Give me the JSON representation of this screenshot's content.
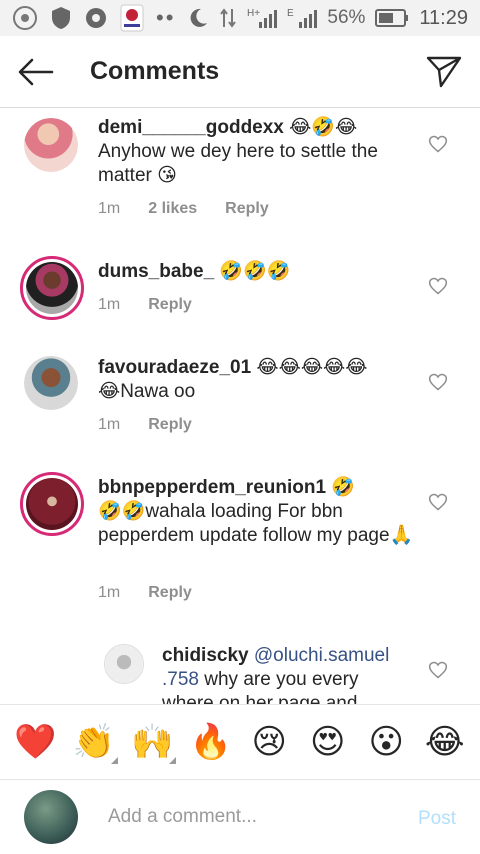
{
  "status_bar": {
    "battery_percent": "56%",
    "time": "11:29",
    "notification_icons": [
      "chrome-icon",
      "shield-icon",
      "aperture-icon",
      "app-icon",
      "dots-icon",
      "moon-icon"
    ]
  },
  "header": {
    "title": "Comments"
  },
  "comments": [
    {
      "username": "demi______goddexx",
      "text_suffix": " 😂🤣😂",
      "body": "Anyhow we dey here to settle the matter 😘",
      "time": "1m",
      "likes": "2 likes",
      "reply_label": "Reply"
    },
    {
      "username": "dums_babe_",
      "text_suffix": " 🤣🤣🤣",
      "body": "",
      "time": "1m",
      "reply_label": "Reply"
    },
    {
      "username": "favouradaeze_01",
      "text_suffix": " 😂😂😂😂😂",
      "body": "😂Nawa oo",
      "time": "1m",
      "reply_label": "Reply"
    },
    {
      "username": "bbnpepperdem_reunion1",
      "text_suffix": " 🤣",
      "body": "🤣🤣wahala loading For bbn pepperdem update follow my page🙏",
      "time": "1m",
      "reply_label": "Reply"
    }
  ],
  "reply": {
    "username": "chidiscky",
    "mention": "@oluchi.samuel .758",
    "body": " why are you every where on her page and"
  },
  "emoji_bar": [
    "❤️",
    "👏",
    "🙌",
    "🔥",
    "😢",
    "😍",
    "😮",
    "😂"
  ],
  "composer": {
    "placeholder": "Add a comment...",
    "post_label": "Post"
  },
  "colors": {
    "story_ring": "#d62976",
    "post_disabled": "#b2dffc",
    "meta_gray": "#8e8e8e"
  }
}
